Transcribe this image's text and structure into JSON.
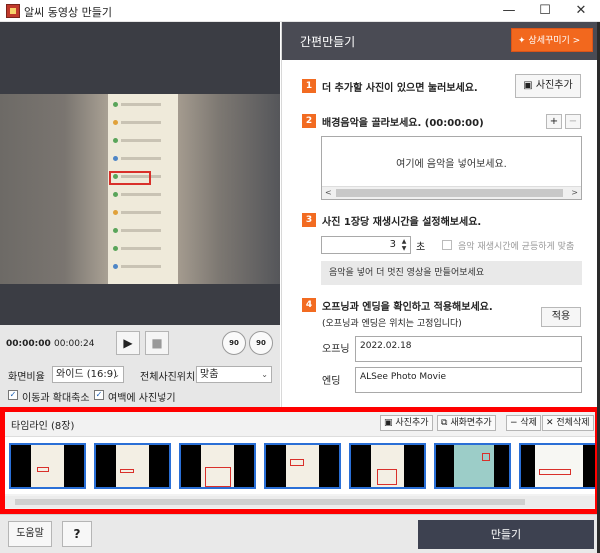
{
  "window": {
    "title": "알씨 동영상 만들기",
    "minimize": "—",
    "maximize": "☐",
    "close": "✕"
  },
  "preview": {
    "time_current": "00:00:00",
    "time_total": "00:00:24",
    "play": "▶",
    "stop": "■",
    "rotate_left": "90",
    "rotate_right": "90"
  },
  "options": {
    "aspect_label": "화면비율",
    "aspect_value": "와이드 (16:9)",
    "position_label": "전체사진위치",
    "position_value": "맞춤",
    "pan_zoom_label": "이동과 확대축소",
    "pan_zoom_checked": true,
    "fill_margin_label": "여백에 사진넣기",
    "fill_margin_checked": true
  },
  "right": {
    "header_title": "간편만들기",
    "detail_button": "상세꾸미기 >",
    "step1": {
      "num": "1",
      "text": "더 추가할 사진이 있으면 눌러보세요.",
      "button": "사진추가"
    },
    "step2": {
      "num": "2",
      "text": "배경음악을 골라보세요. (00:00:00)",
      "add": "+",
      "remove": "−",
      "placeholder": "여기에 음악을 넣어보세요."
    },
    "step3": {
      "num": "3",
      "text": "사진 1장당 재생시간을 설정해보세요.",
      "value": "3",
      "unit": "초",
      "sync_label": "음악 재생시간에 균등하게 맞춤",
      "info": "음악을 넣어 더 멋진 영상을 만들어보세요"
    },
    "step4": {
      "num": "4",
      "text": "오프닝과 엔딩을 확인하고 적용해보세요.",
      "subtext": "(오프닝과 엔딩은 위치는 고정입니다)",
      "apply": "적용",
      "opening_label": "오프닝",
      "opening_value": "2022.02.18",
      "ending_label": "엔딩",
      "ending_value": "ALSee Photo Movie"
    }
  },
  "timeline": {
    "title": "타임라인 (8장)",
    "add_photo": "사진추가",
    "add_new_screen": "새화면추가",
    "delete": "− 삭제",
    "delete_all": "✕ 전체삭제",
    "thumbnail_count": 7
  },
  "bottom": {
    "help": "도움말",
    "question": "?",
    "make": "만들기"
  }
}
